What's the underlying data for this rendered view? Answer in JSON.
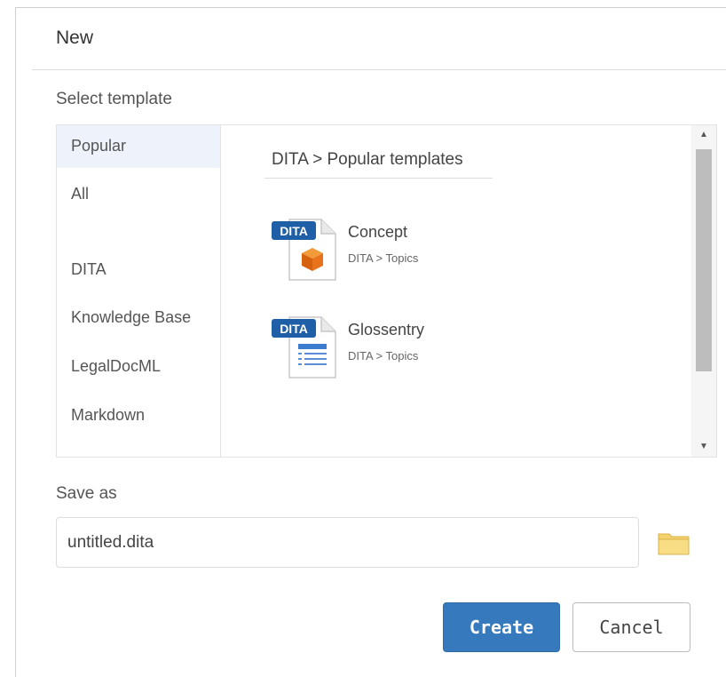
{
  "dialog": {
    "title": "New",
    "select_template_label": "Select template",
    "save_as_label": "Save as"
  },
  "categories": [
    {
      "label": "Popular",
      "selected": true
    },
    {
      "label": "All",
      "selected": false
    },
    {
      "label": "DITA",
      "selected": false
    },
    {
      "label": "Knowledge Base",
      "selected": false
    },
    {
      "label": "LegalDocML",
      "selected": false
    },
    {
      "label": "Markdown",
      "selected": false
    }
  ],
  "template_area": {
    "breadcrumb": "DITA > Popular templates",
    "templates": [
      {
        "name": "Concept",
        "path": "DITA > Topics",
        "badge": "DITA",
        "icon": "cube-icon"
      },
      {
        "name": "Glossentry",
        "path": "DITA > Topics",
        "badge": "DITA",
        "icon": "list-icon"
      }
    ]
  },
  "save_as": {
    "value": "untitled.dita",
    "folder_icon": "folder-icon"
  },
  "buttons": {
    "create": "Create",
    "cancel": "Cancel"
  },
  "colors": {
    "primary": "#3779bd",
    "selected_bg": "#eef3fb",
    "dita_badge": "#1f5fa8",
    "cube": "#e8731c",
    "folder": "#f5d26b"
  }
}
